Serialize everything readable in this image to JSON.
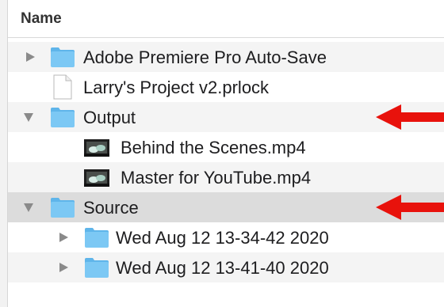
{
  "header": {
    "column_name": "Name"
  },
  "rows": [
    {
      "label": "Adobe Premiere Pro Auto-Save",
      "kind": "folder",
      "disclosure": "collapsed",
      "icon": "folder-icon"
    },
    {
      "label": "Larry's Project v2.prlock",
      "kind": "file",
      "disclosure": "none",
      "icon": "document-icon"
    },
    {
      "label": "Output",
      "kind": "folder",
      "disclosure": "expanded",
      "icon": "folder-icon"
    },
    {
      "label": "Behind the Scenes.mp4",
      "kind": "video",
      "disclosure": "none",
      "icon": "video-thumbnail-icon"
    },
    {
      "label": "Master for YouTube.mp4",
      "kind": "video",
      "disclosure": "none",
      "icon": "video-thumbnail-icon"
    },
    {
      "label": "Source",
      "kind": "folder",
      "disclosure": "expanded",
      "icon": "folder-icon"
    },
    {
      "label": "Wed Aug 12 13-34-42 2020",
      "kind": "folder",
      "disclosure": "collapsed",
      "icon": "folder-icon"
    },
    {
      "label": "Wed Aug 12 13-41-40 2020",
      "kind": "folder",
      "disclosure": "collapsed",
      "icon": "folder-icon"
    }
  ],
  "colors": {
    "folder": "#7cc8f4",
    "folder_tab": "#5fb5ea",
    "annotation_arrow": "#e8120c",
    "selected_row": "#dcdcdc",
    "alt_row": "#f4f4f4"
  },
  "annotations": [
    {
      "icon": "red-arrow-icon",
      "points_to": "Output"
    },
    {
      "icon": "red-arrow-icon",
      "points_to": "Source"
    }
  ]
}
